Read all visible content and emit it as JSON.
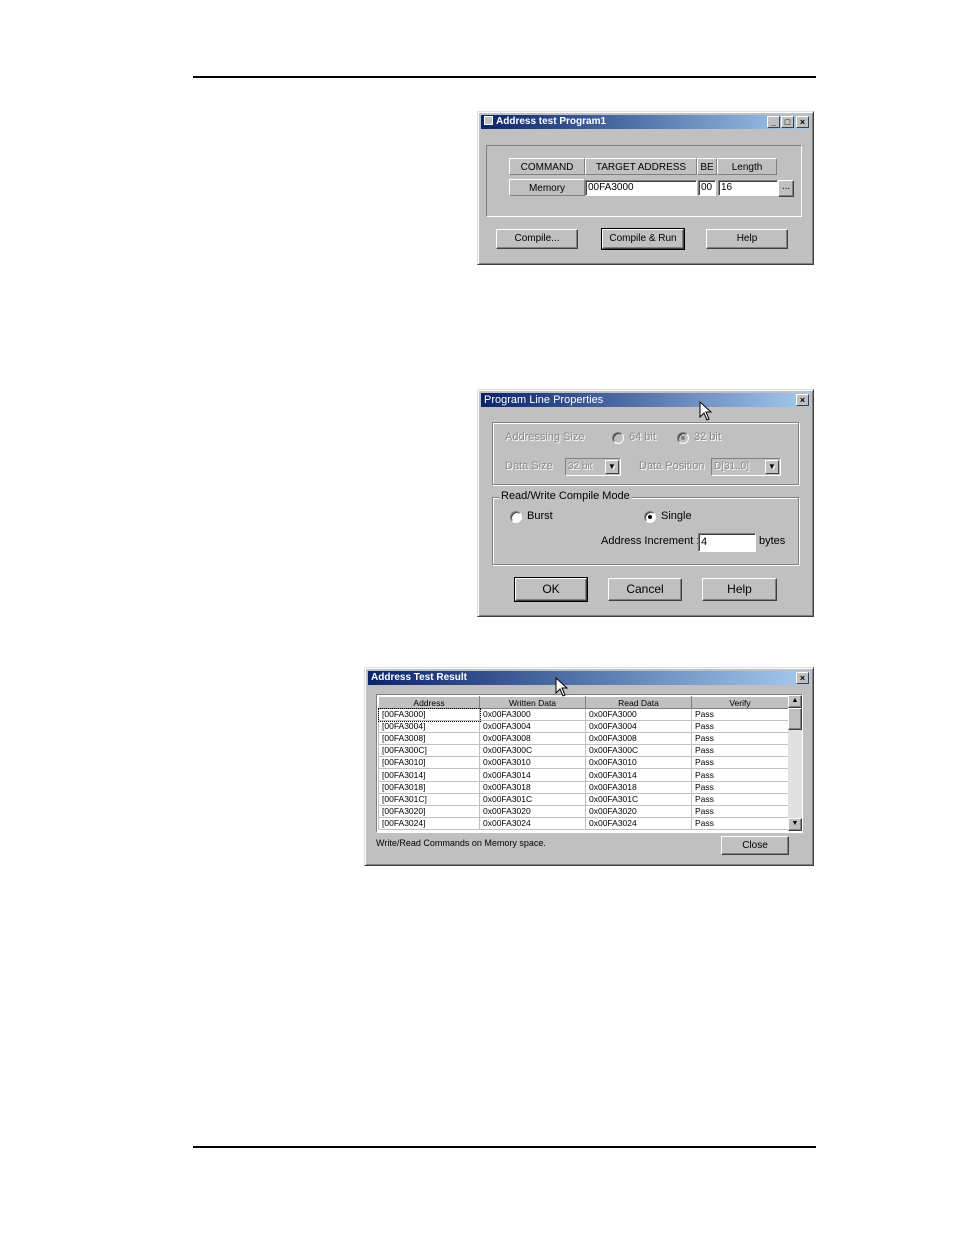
{
  "address_test_program": {
    "title": "Address test Program1",
    "title_buttons": [
      "_",
      "□",
      "×"
    ],
    "columns": [
      "COMMAND",
      "TARGET ADDRESS",
      "BE",
      "Length"
    ],
    "row": {
      "command": "Memory",
      "target_address": "00FA3000",
      "be": "00",
      "length": "16",
      "more_button": "..."
    },
    "buttons": {
      "compile": "Compile...",
      "compile_run": "Compile & Run",
      "help": "Help"
    }
  },
  "program_line_properties": {
    "title": "Program Line Properties",
    "close": "×",
    "addressing_size_label": "Addressing Size",
    "option_64bit": "64 bit",
    "option_32bit": "32 bit",
    "data_size_label": "Data Size",
    "data_size_value": "32 bit",
    "data_position_label": "Data Position",
    "data_position_value": "D[31..0]",
    "mode_group_label": "Read/Write Compile Mode",
    "burst_label": "Burst",
    "single_label": "Single",
    "address_increment_label": "Address Increment :",
    "address_increment_value": "4",
    "bytes_label": "bytes",
    "buttons": {
      "ok": "OK",
      "cancel": "Cancel",
      "help": "Help"
    }
  },
  "address_test_result": {
    "title": "Address Test Result",
    "close": "×",
    "columns": [
      "Address",
      "Written Data",
      "Read Data",
      "Verify"
    ],
    "rows": [
      [
        "[00FA3000]",
        "0x00FA3000",
        "0x00FA3000",
        "Pass"
      ],
      [
        "[00FA3004]",
        "0x00FA3004",
        "0x00FA3004",
        "Pass"
      ],
      [
        "[00FA3008]",
        "0x00FA3008",
        "0x00FA3008",
        "Pass"
      ],
      [
        "[00FA300C]",
        "0x00FA300C",
        "0x00FA300C",
        "Pass"
      ],
      [
        "[00FA3010]",
        "0x00FA3010",
        "0x00FA3010",
        "Pass"
      ],
      [
        "[00FA3014]",
        "0x00FA3014",
        "0x00FA3014",
        "Pass"
      ],
      [
        "[00FA3018]",
        "0x00FA3018",
        "0x00FA3018",
        "Pass"
      ],
      [
        "[00FA301C]",
        "0x00FA301C",
        "0x00FA301C",
        "Pass"
      ],
      [
        "[00FA3020]",
        "0x00FA3020",
        "0x00FA3020",
        "Pass"
      ],
      [
        "[00FA3024]",
        "0x00FA3024",
        "0x00FA3024",
        "Pass"
      ]
    ],
    "status_text": "Write/Read Commands on Memory space.",
    "close_button": "Close"
  }
}
